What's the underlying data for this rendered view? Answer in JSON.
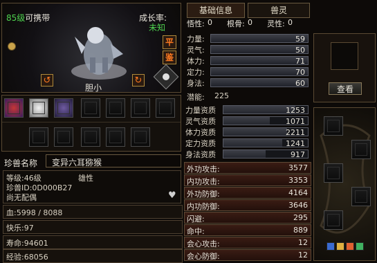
{
  "pet": {
    "level_label": "85级",
    "carry_label": "可携带",
    "growth_label": "成长率:",
    "growth_value": "未知",
    "state_label": "胆小",
    "btn_ping": "平",
    "btn_jian": "鉴"
  },
  "tabs": {
    "basic": "基础信息",
    "beast": "兽灵"
  },
  "traits": {
    "wu_label": "悟性:",
    "wu_value": "0",
    "gen_label": "根骨:",
    "gen_value": "0",
    "ling_label": "灵性:",
    "ling_value": "0"
  },
  "attributes": [
    {
      "label": "力量:",
      "value": "59"
    },
    {
      "label": "灵气:",
      "value": "50"
    },
    {
      "label": "体力:",
      "value": "71"
    },
    {
      "label": "定力:",
      "value": "70"
    },
    {
      "label": "身法:",
      "value": "60"
    }
  ],
  "potential": {
    "label": "潜能:",
    "value": "225"
  },
  "aptitudes": [
    {
      "label": "力量资质",
      "value": "1253",
      "fill": 0.85
    },
    {
      "label": "灵气资质",
      "value": "1071",
      "fill": 0.55
    },
    {
      "label": "体力资质",
      "value": "2211",
      "fill": 0.75
    },
    {
      "label": "定力资质",
      "value": "1241",
      "fill": 0.7
    },
    {
      "label": "身法资质",
      "value": "917",
      "fill": 0.5
    }
  ],
  "combat": [
    {
      "label": "外功攻击:",
      "value": "3577"
    },
    {
      "label": "内功攻击:",
      "value": "3353"
    },
    {
      "label": "外功防御:",
      "value": "4164"
    },
    {
      "label": "内功防御:",
      "value": "3646"
    },
    {
      "label": "闪避:",
      "value": "295"
    },
    {
      "label": "命中:",
      "value": "889"
    },
    {
      "label": "会心攻击:",
      "value": "12"
    },
    {
      "label": "会心防御:",
      "value": "12"
    }
  ],
  "info": {
    "name_label": "珍兽名称",
    "name_value": "变异六耳猕猴",
    "level": "等级:46级",
    "gender": "雄性",
    "pet_id": "珍兽ID:0D000B27",
    "mate": "尚无配偶",
    "hp": "血:5998 / 8088",
    "happy": "快乐:97",
    "life": "寿命:94601",
    "exp": "经验:68056"
  },
  "view_button": "查看",
  "colors": {
    "green": "#4fd34f",
    "orange": "#ff7a20",
    "bar": "#3a1c14"
  }
}
